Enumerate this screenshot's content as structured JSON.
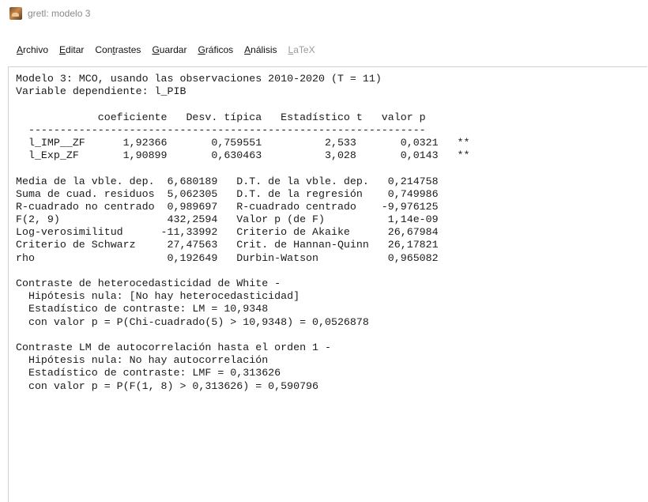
{
  "window": {
    "title": "gretl: modelo 3"
  },
  "menu": {
    "items": [
      {
        "ul": "A",
        "rest": "rchivo"
      },
      {
        "ul": "E",
        "rest": "ditar"
      },
      {
        "pre": "Con",
        "ul": "t",
        "rest": "rastes"
      },
      {
        "ul": "G",
        "rest": "uardar"
      },
      {
        "ul": "G",
        "rest": "ráficos"
      },
      {
        "ul": "A",
        "rest": "nálisis"
      },
      {
        "ul": "L",
        "rest": "aTeX"
      }
    ]
  },
  "output": {
    "lines": [
      "Modelo 3: MCO, usando las observaciones 2010-2020 (T = 11)",
      "Variable dependiente: l_PIB",
      "",
      "             coeficiente   Desv. típica   Estadístico t   valor p",
      "  ---------------------------------------------------------------",
      "  l_IMP__ZF      1,92366       0,759551          2,533       0,0321   **",
      "  l_Exp_ZF       1,90899       0,630463          3,028       0,0143   **",
      "",
      "Media de la vble. dep.  6,680189   D.T. de la vble. dep.   0,214758",
      "Suma de cuad. residuos  5,062305   D.T. de la regresión    0,749986",
      "R-cuadrado no centrado  0,989697   R-cuadrado centrado    -9,976125",
      "F(2, 9)                 432,2594   Valor p (de F)          1,14e-09",
      "Log-verosimilitud      -11,33992   Criterio de Akaike      26,67984",
      "Criterio de Schwarz     27,47563   Crit. de Hannan-Quinn   26,17821",
      "rho                     0,192649   Durbin-Watson           0,965082",
      "",
      "Contraste de heterocedasticidad de White -",
      "  Hipótesis nula: [No hay heterocedasticidad]",
      "  Estadístico de contraste: LM = 10,9348",
      "  con valor p = P(Chi-cuadrado(5) > 10,9348) = 0,0526878",
      "",
      "Contraste LM de autocorrelación hasta el orden 1 -",
      "  Hipótesis nula: No hay autocorrelación",
      "  Estadístico de contraste: LMF = 0,313626",
      "  con valor p = P(F(1, 8) > 0,313626) = 0,590796"
    ]
  }
}
